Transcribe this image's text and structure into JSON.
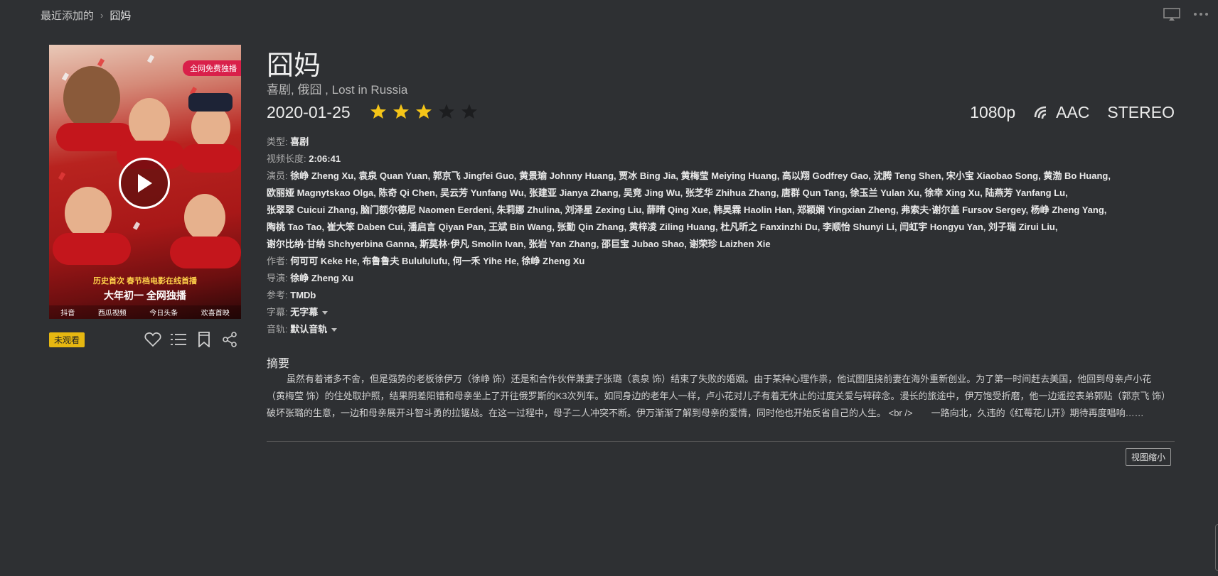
{
  "breadcrumb": {
    "parent": "最近添加的",
    "separator": "›",
    "current": "囧妈"
  },
  "icons": {
    "cast": "screen-cast-icon",
    "more": "more-dots-icon"
  },
  "poster": {
    "badge": "全网免费独播",
    "tagline1": "历史首次 春节档电影在线首播",
    "tagline2": "大年初一  全网独播",
    "logos": [
      "抖音",
      "西瓜视频",
      "今日头条",
      "欢喜首映"
    ]
  },
  "status_badge": "未观看",
  "movie": {
    "title": "囧妈",
    "genres": "喜剧, 俄囧 , Lost in Russia",
    "date": "2020-01-25",
    "rating_stars": 3,
    "rating_max": 5,
    "resolution": "1080p",
    "audio_codec": "AAC",
    "channels": "STEREO"
  },
  "meta": {
    "type_label": "类型:",
    "type_value": "喜剧",
    "length_label": "视频长度:",
    "length_value": "2:06:41",
    "cast_label": "演员:",
    "cast_lines": [
      "徐峥 Zheng Xu, 袁泉 Quan Yuan, 郭京飞 Jingfei Guo, 黄景瑜 Johnny Huang, 贾冰 Bing Jia, 黄梅莹 Meiying Huang, 高以翔 Godfrey Gao, 沈腾 Teng Shen, 宋小宝 Xiaobao Song, 黄渤 Bo Huang,",
      "欧丽娅 Magnytskao Olga, 陈奇 Qi Chen, 吴云芳 Yunfang Wu, 张建亚 Jianya Zhang, 吴竞 Jing Wu, 张芝华 Zhihua Zhang, 唐群 Qun Tang, 徐玉兰 Yulan Xu, 徐幸 Xing Xu, 陆燕芳 Yanfang Lu,",
      "张翠翠 Cuicui Zhang, 脑门额尔德尼 Naomen Eerdeni, 朱莉娜 Zhulina, 刘泽星 Zexing Liu, 薛晴 Qing Xue, 韩昊霖 Haolin Han, 郑颖娴 Yingxian Zheng, 弗索夫·谢尔盖 Fursov Sergey, 杨峥 Zheng Yang,",
      "陶桃 Tao Tao, 崔大笨 Daben Cui, 潘启言 Qiyan Pan, 王斌 Bin Wang, 张勤 Qin Zhang, 黄梓凌 Ziling Huang, 杜凡昕之 Fanxinzhi Du, 李顺怡 Shunyi Li, 闫虹宇 Hongyu Yan, 刘子瑞 Zirui Liu,",
      "谢尔比纳·甘纳 Shchyerbina Ganna, 斯莫林·伊凡 Smolin Ivan, 张岩 Yan Zhang, 邵巨宝 Jubao Shao, 谢荣珍 Laizhen Xie"
    ],
    "writer_label": "作者:",
    "writer_value": "何可可 Keke He, 布鲁鲁夫 Bulululufu, 何一禾 Yihe He, 徐峥 Zheng Xu",
    "director_label": "导演:",
    "director_value": "徐峥 Zheng Xu",
    "ref_label": "参考:",
    "ref_value": "TMDb",
    "subtitle_label": "字幕:",
    "subtitle_value": "无字幕",
    "audio_label": "音轨:",
    "audio_value": "默认音轨"
  },
  "summary": {
    "heading": "摘要",
    "text": "虽然有着诸多不舍，但是强势的老板徐伊万（徐峥 饰）还是和合作伙伴兼妻子张璐（袁泉 饰）结束了失败的婚姻。由于某种心理作祟，他试图阻挠前妻在海外重新创业。为了第一时间赶去美国，他回到母亲卢小花（黄梅莹 饰）的住处取护照，结果阴差阳错和母亲坐上了开往俄罗斯的K3次列车。如同身边的老年人一样，卢小花对儿子有着无休止的过度关爱与碎碎念。漫长的旅途中，伊万饱受折磨，他一边遥控表弟郭贴（郭京飞 饰）破坏张璐的生意，一边和母亲展开斗智斗勇的拉锯战。在这一过程中，母子二人冲突不断。伊万渐渐了解到母亲的爱情，同时他也开始反省自己的人生。 <br />　　一路向北，久违的《红莓花儿开》期待再度唱响……"
  },
  "collapse_label": "视图缩小",
  "colors": {
    "background": "#2e3033",
    "star_on": "#f5c518",
    "star_off": "#1c1d1f",
    "badge": "#e6b711"
  }
}
